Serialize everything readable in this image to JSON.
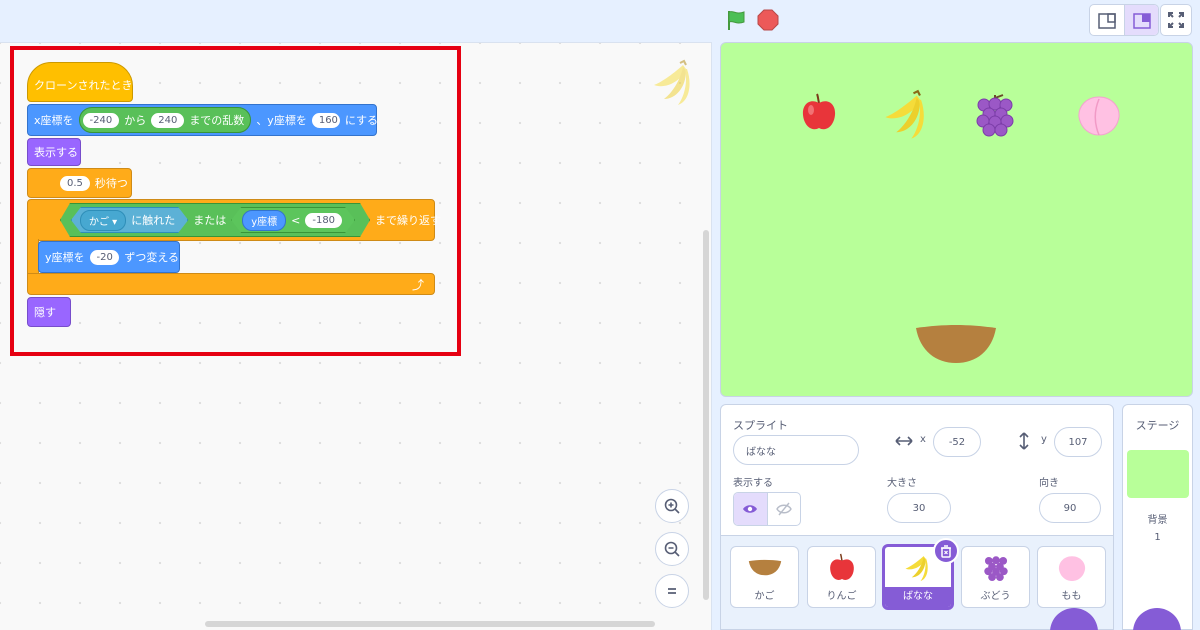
{
  "header": {
    "flag_icon": "green-flag-icon",
    "stop_icon": "stop-icon",
    "layout_buttons": [
      "small-stage-icon",
      "normal-stage-icon"
    ],
    "fullscreen_icon": "fullscreen-icon"
  },
  "script": {
    "hat": "クローンされたとき",
    "goto": {
      "prefix": "x座標を",
      "from": "-240",
      "kara": "から",
      "to": "240",
      "made": "までの乱数",
      "sep": "、y座標を",
      "y": "160",
      "suffix": "にする"
    },
    "show": "表示する",
    "wait": {
      "value": "0.5",
      "label": "秒待つ"
    },
    "repeat_until": {
      "sensing_menu": "かご ▾",
      "sensing_label": "に触れた",
      "or": "または",
      "reporter": "y座標",
      "lt": "<",
      "value": "-180",
      "label": "まで繰り返す"
    },
    "change_y": {
      "prefix": "y座標を",
      "value": "-20",
      "suffix": "ずつ変える"
    },
    "loop_arrow": "⤴",
    "hide": "隠す"
  },
  "zoom": {
    "in": "zoom-in-icon",
    "out": "zoom-out-icon",
    "reset": "zoom-reset-icon"
  },
  "sprite_info": {
    "title": "スプライト",
    "name": "ばなな",
    "x_label": "x",
    "x": "-52",
    "y_label": "y",
    "y": "107",
    "show_label": "表示する",
    "size_label": "大きさ",
    "size": "30",
    "direction_label": "向き",
    "direction": "90"
  },
  "sprites": [
    {
      "name": "かご"
    },
    {
      "name": "りんご"
    },
    {
      "name": "ばなな"
    },
    {
      "name": "ぶどう"
    },
    {
      "name": "もも"
    }
  ],
  "stage_panel": {
    "title": "ステージ",
    "backdrop_label": "背景",
    "backdrop_count": "1"
  },
  "colors": {
    "motion": "#4c97ff",
    "looks": "#9966ff",
    "control": "#ffab19",
    "events": "#ffbf00",
    "operators": "#59c059",
    "sensing": "#5cb1d6",
    "stage_bg": "#b8ff99",
    "highlight": "#e60012",
    "accent": "#855cd6"
  }
}
